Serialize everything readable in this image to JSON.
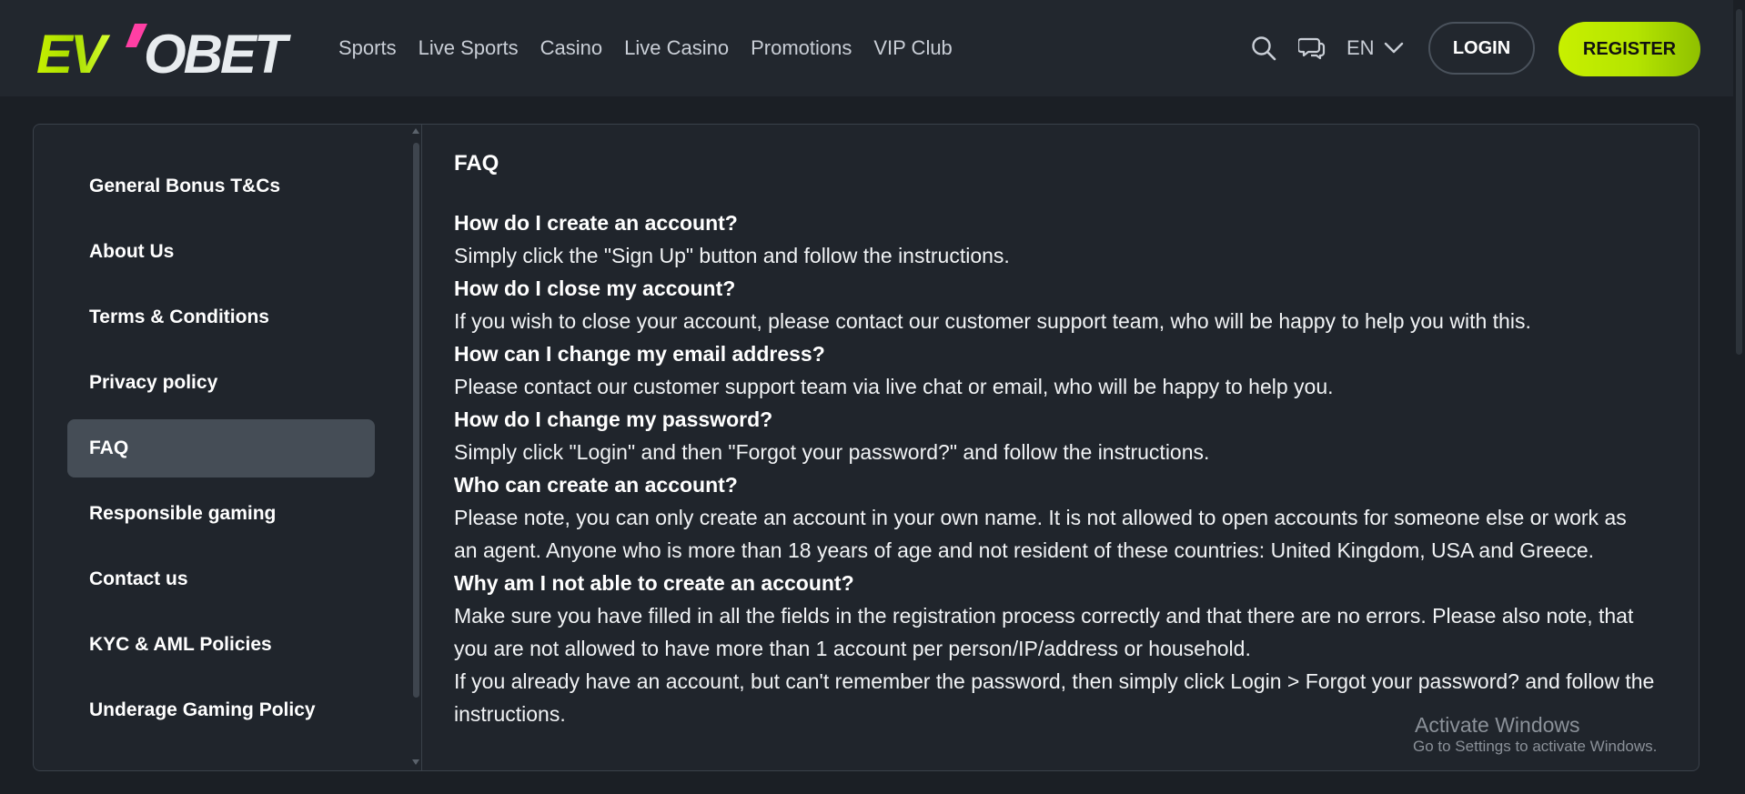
{
  "header": {
    "logo_text": "EVOBET",
    "nav": [
      "Sports",
      "Live Sports",
      "Casino",
      "Live Casino",
      "Promotions",
      "VIP Club"
    ],
    "language": "EN",
    "login_label": "LOGIN",
    "register_label": "REGISTER",
    "icons": [
      "search-icon",
      "chat-icon",
      "chevron-down-icon"
    ]
  },
  "colors": {
    "background": "#1b1f25",
    "header": "#22272e",
    "accent": "#c8f000",
    "active_item": "#454d56"
  },
  "sidebar": {
    "items": [
      {
        "label": "General Bonus T&Cs",
        "active": false
      },
      {
        "label": "About Us",
        "active": false
      },
      {
        "label": "Terms & Conditions",
        "active": false
      },
      {
        "label": "Privacy policy",
        "active": false
      },
      {
        "label": "FAQ",
        "active": true
      },
      {
        "label": "Responsible gaming",
        "active": false
      },
      {
        "label": "Contact us",
        "active": false
      },
      {
        "label": "KYC & AML Policies",
        "active": false
      },
      {
        "label": "Underage Gaming Policy",
        "active": false
      }
    ]
  },
  "content": {
    "title": "FAQ",
    "faq": [
      {
        "q": "How do I create an account?",
        "a": [
          "Simply click the \"Sign Up\" button and follow the instructions."
        ]
      },
      {
        "q": "How do I close my account?",
        "a": [
          "If you wish to close your account, please contact our customer support team, who will be happy to help you with this."
        ]
      },
      {
        "q": "How can I change my email address?",
        "a": [
          "Please contact our customer support team via live chat or email, who will be happy to help you."
        ]
      },
      {
        "q": "How do I change my password?",
        "a": [
          "Simply click \"Login\" and then \"Forgot your password?\" and follow the instructions."
        ]
      },
      {
        "q": "Who can create an account?",
        "a": [
          "Please note, you can only create an account in your own name. It is not allowed to open accounts for someone else or work as an agent. Anyone who is more than 18 years of age and not resident of these countries: United Kingdom, USA and Greece."
        ]
      },
      {
        "q": "Why am I not able to create an account?",
        "a": [
          "Make sure you have filled in all the fields in the registration process correctly and that there are no errors. Please also note, that you are not allowed to have more than 1 account per person/IP/address or household.",
          "If you already have an account, but can't remember the password, then simply click Login > Forgot your password? and follow the instructions."
        ]
      }
    ]
  },
  "watermark": {
    "line1": "Activate Windows",
    "line2": "Go to Settings to activate Windows."
  }
}
